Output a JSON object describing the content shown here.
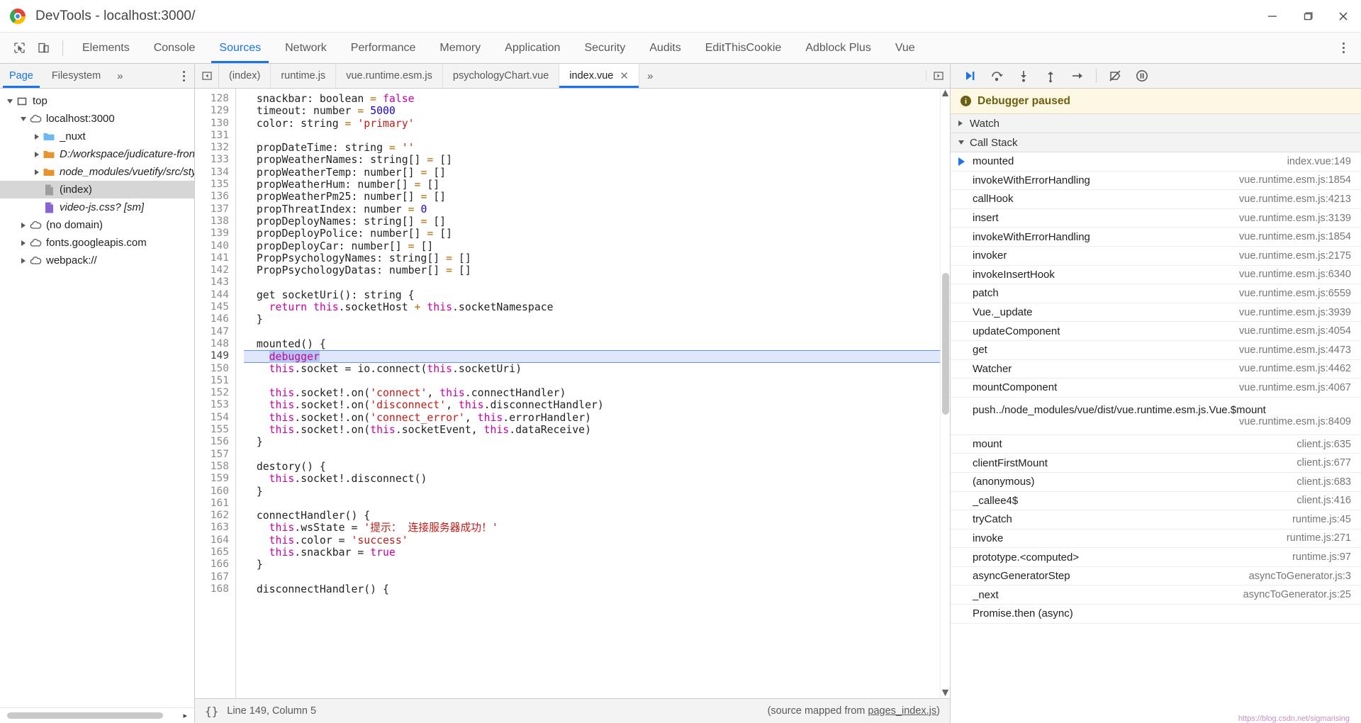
{
  "window": {
    "title": "DevTools - localhost:3000/",
    "minimize_label": "minimize-icon",
    "maximize_label": "maximize-icon",
    "close_label": "close-icon"
  },
  "main_tabs": [
    {
      "label": "Elements",
      "active": false
    },
    {
      "label": "Console",
      "active": false
    },
    {
      "label": "Sources",
      "active": true
    },
    {
      "label": "Network",
      "active": false
    },
    {
      "label": "Performance",
      "active": false
    },
    {
      "label": "Memory",
      "active": false
    },
    {
      "label": "Application",
      "active": false
    },
    {
      "label": "Security",
      "active": false
    },
    {
      "label": "Audits",
      "active": false
    },
    {
      "label": "EditThisCookie",
      "active": false
    },
    {
      "label": "Adblock Plus",
      "active": false
    },
    {
      "label": "Vue",
      "active": false
    }
  ],
  "navigator": {
    "tabs": [
      {
        "label": "Page",
        "active": true
      },
      {
        "label": "Filesystem",
        "active": false
      }
    ],
    "more_label": "»",
    "tree": [
      {
        "label": "top",
        "indent": 0,
        "twist": "down",
        "icon": "frame",
        "italic": false,
        "selected": false
      },
      {
        "label": "localhost:3000",
        "indent": 1,
        "twist": "down",
        "icon": "cloud",
        "italic": false,
        "selected": false
      },
      {
        "label": "_nuxt",
        "indent": 2,
        "twist": "right",
        "icon": "folder-blue",
        "italic": false,
        "selected": false
      },
      {
        "label": "D:/workspace/judicature-fronte",
        "indent": 2,
        "twist": "right",
        "icon": "folder-orange",
        "italic": true,
        "selected": false
      },
      {
        "label": "node_modules/vuetify/src/stylu",
        "indent": 2,
        "twist": "right",
        "icon": "folder-orange",
        "italic": true,
        "selected": false
      },
      {
        "label": "(index)",
        "indent": 2,
        "twist": "none",
        "icon": "file-gray",
        "italic": false,
        "selected": true
      },
      {
        "label": "video-js.css? [sm]",
        "indent": 2,
        "twist": "none",
        "icon": "file-purple",
        "italic": true,
        "selected": false
      },
      {
        "label": "(no domain)",
        "indent": 1,
        "twist": "right",
        "icon": "cloud",
        "italic": false,
        "selected": false
      },
      {
        "label": "fonts.googleapis.com",
        "indent": 1,
        "twist": "right",
        "icon": "cloud",
        "italic": false,
        "selected": false
      },
      {
        "label": "webpack://",
        "indent": 1,
        "twist": "right",
        "icon": "cloud",
        "italic": false,
        "selected": false
      }
    ]
  },
  "editor": {
    "tabs": [
      {
        "label": "(index)",
        "active": false,
        "closable": false
      },
      {
        "label": "runtime.js",
        "active": false,
        "closable": false
      },
      {
        "label": "vue.runtime.esm.js",
        "active": false,
        "closable": false
      },
      {
        "label": "psychologyChart.vue",
        "active": false,
        "closable": false
      },
      {
        "label": "index.vue",
        "active": true,
        "closable": true
      }
    ],
    "close_glyph": "✕",
    "more_label": "»",
    "first_line": 128,
    "exec_line": 149,
    "lines": [
      {
        "n": 128,
        "tokens": [
          {
            "t": "  snackbar: boolean ",
            "c": "cn"
          },
          {
            "t": "= ",
            "c": "op"
          },
          {
            "t": "false",
            "c": "kw"
          }
        ]
      },
      {
        "n": 129,
        "tokens": [
          {
            "t": "  timeout: number ",
            "c": "cn"
          },
          {
            "t": "= ",
            "c": "op"
          },
          {
            "t": "5000",
            "c": "num"
          }
        ]
      },
      {
        "n": 130,
        "tokens": [
          {
            "t": "  color: string ",
            "c": "cn"
          },
          {
            "t": "= ",
            "c": "op"
          },
          {
            "t": "'primary'",
            "c": "str"
          }
        ]
      },
      {
        "n": 131,
        "tokens": []
      },
      {
        "n": 132,
        "tokens": [
          {
            "t": "  propDateTime: string ",
            "c": "cn"
          },
          {
            "t": "= ",
            "c": "op"
          },
          {
            "t": "''",
            "c": "str"
          }
        ]
      },
      {
        "n": 133,
        "tokens": [
          {
            "t": "  propWeatherNames: string[] ",
            "c": "cn"
          },
          {
            "t": "= ",
            "c": "op"
          },
          {
            "t": "[]",
            "c": "cn"
          }
        ]
      },
      {
        "n": 134,
        "tokens": [
          {
            "t": "  propWeatherTemp: number[] ",
            "c": "cn"
          },
          {
            "t": "= ",
            "c": "op"
          },
          {
            "t": "[]",
            "c": "cn"
          }
        ]
      },
      {
        "n": 135,
        "tokens": [
          {
            "t": "  propWeatherHum: number[] ",
            "c": "cn"
          },
          {
            "t": "= ",
            "c": "op"
          },
          {
            "t": "[]",
            "c": "cn"
          }
        ]
      },
      {
        "n": 136,
        "tokens": [
          {
            "t": "  propWeatherPm25: number[] ",
            "c": "cn"
          },
          {
            "t": "= ",
            "c": "op"
          },
          {
            "t": "[]",
            "c": "cn"
          }
        ]
      },
      {
        "n": 137,
        "tokens": [
          {
            "t": "  propThreatIndex: number ",
            "c": "cn"
          },
          {
            "t": "= ",
            "c": "op"
          },
          {
            "t": "0",
            "c": "num"
          }
        ]
      },
      {
        "n": 138,
        "tokens": [
          {
            "t": "  propDeployNames: string[] ",
            "c": "cn"
          },
          {
            "t": "= ",
            "c": "op"
          },
          {
            "t": "[]",
            "c": "cn"
          }
        ]
      },
      {
        "n": 139,
        "tokens": [
          {
            "t": "  propDeployPolice: number[] ",
            "c": "cn"
          },
          {
            "t": "= ",
            "c": "op"
          },
          {
            "t": "[]",
            "c": "cn"
          }
        ]
      },
      {
        "n": 140,
        "tokens": [
          {
            "t": "  propDeployCar: number[] ",
            "c": "cn"
          },
          {
            "t": "= ",
            "c": "op"
          },
          {
            "t": "[]",
            "c": "cn"
          }
        ]
      },
      {
        "n": 141,
        "tokens": [
          {
            "t": "  PropPsychologyNames: string[] ",
            "c": "cn"
          },
          {
            "t": "= ",
            "c": "op"
          },
          {
            "t": "[]",
            "c": "cn"
          }
        ]
      },
      {
        "n": 142,
        "tokens": [
          {
            "t": "  PropPsychologyDatas: number[] ",
            "c": "cn"
          },
          {
            "t": "= ",
            "c": "op"
          },
          {
            "t": "[]",
            "c": "cn"
          }
        ]
      },
      {
        "n": 143,
        "tokens": []
      },
      {
        "n": 144,
        "tokens": [
          {
            "t": "  get socketUri(): string {",
            "c": "cn"
          }
        ]
      },
      {
        "n": 145,
        "tokens": [
          {
            "t": "    ",
            "c": "cn"
          },
          {
            "t": "return ",
            "c": "kw"
          },
          {
            "t": "this",
            "c": "kw"
          },
          {
            "t": ".socketHost ",
            "c": "cn"
          },
          {
            "t": "+ ",
            "c": "op"
          },
          {
            "t": "this",
            "c": "kw"
          },
          {
            "t": ".socketNamespace",
            "c": "cn"
          }
        ]
      },
      {
        "n": 146,
        "tokens": [
          {
            "t": "  }",
            "c": "cn"
          }
        ]
      },
      {
        "n": 147,
        "tokens": []
      },
      {
        "n": 148,
        "tokens": [
          {
            "t": "  mounted() {",
            "c": "cn"
          }
        ]
      },
      {
        "n": 149,
        "tokens": [
          {
            "t": "    ",
            "c": "cn"
          },
          {
            "t": "debugger",
            "c": "dbg"
          }
        ],
        "exec": true
      },
      {
        "n": 150,
        "tokens": [
          {
            "t": "    ",
            "c": "cn"
          },
          {
            "t": "this",
            "c": "kw"
          },
          {
            "t": ".socket = io.connect(",
            "c": "cn"
          },
          {
            "t": "this",
            "c": "kw"
          },
          {
            "t": ".socketUri)",
            "c": "cn"
          }
        ]
      },
      {
        "n": 151,
        "tokens": []
      },
      {
        "n": 152,
        "tokens": [
          {
            "t": "    ",
            "c": "cn"
          },
          {
            "t": "this",
            "c": "kw"
          },
          {
            "t": ".socket!.on(",
            "c": "cn"
          },
          {
            "t": "'connect'",
            "c": "str"
          },
          {
            "t": ", ",
            "c": "cn"
          },
          {
            "t": "this",
            "c": "kw"
          },
          {
            "t": ".connectHandler)",
            "c": "cn"
          }
        ]
      },
      {
        "n": 153,
        "tokens": [
          {
            "t": "    ",
            "c": "cn"
          },
          {
            "t": "this",
            "c": "kw"
          },
          {
            "t": ".socket!.on(",
            "c": "cn"
          },
          {
            "t": "'disconnect'",
            "c": "str"
          },
          {
            "t": ", ",
            "c": "cn"
          },
          {
            "t": "this",
            "c": "kw"
          },
          {
            "t": ".disconnectHandler)",
            "c": "cn"
          }
        ]
      },
      {
        "n": 154,
        "tokens": [
          {
            "t": "    ",
            "c": "cn"
          },
          {
            "t": "this",
            "c": "kw"
          },
          {
            "t": ".socket!.on(",
            "c": "cn"
          },
          {
            "t": "'connect_error'",
            "c": "str"
          },
          {
            "t": ", ",
            "c": "cn"
          },
          {
            "t": "this",
            "c": "kw"
          },
          {
            "t": ".errorHandler)",
            "c": "cn"
          }
        ]
      },
      {
        "n": 155,
        "tokens": [
          {
            "t": "    ",
            "c": "cn"
          },
          {
            "t": "this",
            "c": "kw"
          },
          {
            "t": ".socket!.on(",
            "c": "cn"
          },
          {
            "t": "this",
            "c": "kw"
          },
          {
            "t": ".socketEvent, ",
            "c": "cn"
          },
          {
            "t": "this",
            "c": "kw"
          },
          {
            "t": ".dataReceive)",
            "c": "cn"
          }
        ]
      },
      {
        "n": 156,
        "tokens": [
          {
            "t": "  }",
            "c": "cn"
          }
        ]
      },
      {
        "n": 157,
        "tokens": []
      },
      {
        "n": 158,
        "tokens": [
          {
            "t": "  destory() {",
            "c": "cn"
          }
        ]
      },
      {
        "n": 159,
        "tokens": [
          {
            "t": "    ",
            "c": "cn"
          },
          {
            "t": "this",
            "c": "kw"
          },
          {
            "t": ".socket!.disconnect()",
            "c": "cn"
          }
        ]
      },
      {
        "n": 160,
        "tokens": [
          {
            "t": "  }",
            "c": "cn"
          }
        ]
      },
      {
        "n": 161,
        "tokens": []
      },
      {
        "n": 162,
        "tokens": [
          {
            "t": "  connectHandler() {",
            "c": "cn"
          }
        ]
      },
      {
        "n": 163,
        "tokens": [
          {
            "t": "    ",
            "c": "cn"
          },
          {
            "t": "this",
            "c": "kw"
          },
          {
            "t": ".wsState = ",
            "c": "cn"
          },
          {
            "t": "'提示： 连接服务器成功！'",
            "c": "str"
          }
        ]
      },
      {
        "n": 164,
        "tokens": [
          {
            "t": "    ",
            "c": "cn"
          },
          {
            "t": "this",
            "c": "kw"
          },
          {
            "t": ".color = ",
            "c": "cn"
          },
          {
            "t": "'success'",
            "c": "str"
          }
        ]
      },
      {
        "n": 165,
        "tokens": [
          {
            "t": "    ",
            "c": "cn"
          },
          {
            "t": "this",
            "c": "kw"
          },
          {
            "t": ".snackbar = ",
            "c": "cn"
          },
          {
            "t": "true",
            "c": "kw"
          }
        ]
      },
      {
        "n": 166,
        "tokens": [
          {
            "t": "  }",
            "c": "cn"
          }
        ]
      },
      {
        "n": 167,
        "tokens": []
      },
      {
        "n": 168,
        "tokens": [
          {
            "t": "  disconnectHandler() {",
            "c": "cn"
          }
        ]
      }
    ],
    "status": {
      "braces": "{}",
      "position": "Line 149, Column 5",
      "source_map_prefix": "(source mapped from ",
      "source_map_link": "pages_index.js",
      "source_map_suffix": ")"
    }
  },
  "debugger": {
    "toolbar": [
      {
        "name": "resume-button",
        "glyph": "resume"
      },
      {
        "name": "step-over-button",
        "glyph": "step-over"
      },
      {
        "name": "step-into-button",
        "glyph": "step-into"
      },
      {
        "name": "step-out-button",
        "glyph": "step-out"
      },
      {
        "name": "step-button",
        "glyph": "step"
      },
      {
        "name": "deactivate-breakpoints-button",
        "glyph": "deactivate"
      },
      {
        "name": "pause-on-exceptions-button",
        "glyph": "pause"
      }
    ],
    "paused_banner": {
      "icon": "i",
      "text": "Debugger paused"
    },
    "watch": {
      "label": "Watch",
      "expanded": false
    },
    "call_stack": {
      "label": "Call Stack",
      "expanded": true
    },
    "frames": [
      {
        "name": "mounted",
        "location": "index.vue:149",
        "active": true,
        "two_line": false
      },
      {
        "name": "invokeWithErrorHandling",
        "location": "vue.runtime.esm.js:1854",
        "active": false,
        "two_line": false
      },
      {
        "name": "callHook",
        "location": "vue.runtime.esm.js:4213",
        "active": false,
        "two_line": false
      },
      {
        "name": "insert",
        "location": "vue.runtime.esm.js:3139",
        "active": false,
        "two_line": false
      },
      {
        "name": "invokeWithErrorHandling",
        "location": "vue.runtime.esm.js:1854",
        "active": false,
        "two_line": false
      },
      {
        "name": "invoker",
        "location": "vue.runtime.esm.js:2175",
        "active": false,
        "two_line": false
      },
      {
        "name": "invokeInsertHook",
        "location": "vue.runtime.esm.js:6340",
        "active": false,
        "two_line": false
      },
      {
        "name": "patch",
        "location": "vue.runtime.esm.js:6559",
        "active": false,
        "two_line": false
      },
      {
        "name": "Vue._update",
        "location": "vue.runtime.esm.js:3939",
        "active": false,
        "two_line": false
      },
      {
        "name": "updateComponent",
        "location": "vue.runtime.esm.js:4054",
        "active": false,
        "two_line": false
      },
      {
        "name": "get",
        "location": "vue.runtime.esm.js:4473",
        "active": false,
        "two_line": false
      },
      {
        "name": "Watcher",
        "location": "vue.runtime.esm.js:4462",
        "active": false,
        "two_line": false
      },
      {
        "name": "mountComponent",
        "location": "vue.runtime.esm.js:4067",
        "active": false,
        "two_line": false
      },
      {
        "name": "push../node_modules/vue/dist/vue.runtime.esm.js.Vue.$mount",
        "location": "vue.runtime.esm.js:8409",
        "active": false,
        "two_line": true
      },
      {
        "name": "mount",
        "location": "client.js:635",
        "active": false,
        "two_line": false
      },
      {
        "name": "clientFirstMount",
        "location": "client.js:677",
        "active": false,
        "two_line": false
      },
      {
        "name": "(anonymous)",
        "location": "client.js:683",
        "active": false,
        "two_line": false
      },
      {
        "name": "_callee4$",
        "location": "client.js:416",
        "active": false,
        "two_line": false
      },
      {
        "name": "tryCatch",
        "location": "runtime.js:45",
        "active": false,
        "two_line": false
      },
      {
        "name": "invoke",
        "location": "runtime.js:271",
        "active": false,
        "two_line": false
      },
      {
        "name": "prototype.<computed>",
        "location": "runtime.js:97",
        "active": false,
        "two_line": false
      },
      {
        "name": "asyncGeneratorStep",
        "location": "asyncToGenerator.js:3",
        "active": false,
        "two_line": false
      },
      {
        "name": "_next",
        "location": "asyncToGenerator.js:25",
        "active": false,
        "two_line": false
      },
      {
        "name": "Promise.then (async)",
        "location": "",
        "active": false,
        "two_line": false
      }
    ],
    "watermark": "https://blog.csdn.net/sigmarising"
  }
}
